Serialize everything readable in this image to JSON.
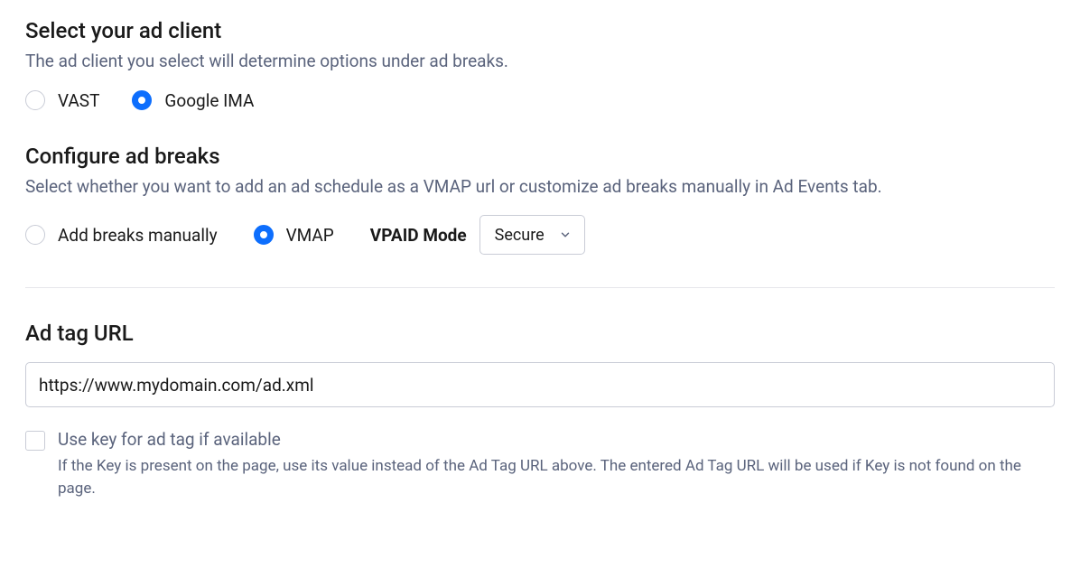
{
  "adClient": {
    "title": "Select your ad client",
    "desc": "The ad client you select will determine options under ad breaks.",
    "options": {
      "vast": "VAST",
      "googleIma": "Google IMA"
    },
    "selected": "googleIma"
  },
  "adBreaks": {
    "title": "Configure ad breaks",
    "desc": "Select whether you want to add an ad schedule as a VMAP url or customize ad breaks manually in Ad Events tab.",
    "options": {
      "manual": "Add breaks manually",
      "vmap": "VMAP"
    },
    "selected": "vmap",
    "vpaid": {
      "label": "VPAID Mode",
      "value": "Secure"
    }
  },
  "adTag": {
    "title": "Ad tag URL",
    "value": "https://www.mydomain.com/ad.xml",
    "useKey": {
      "label": "Use key for ad tag if available",
      "help": "If the Key is present on the page, use its value instead of the Ad Tag URL above. The entered Ad Tag URL will be used if Key is not found on the page.",
      "checked": false
    }
  }
}
